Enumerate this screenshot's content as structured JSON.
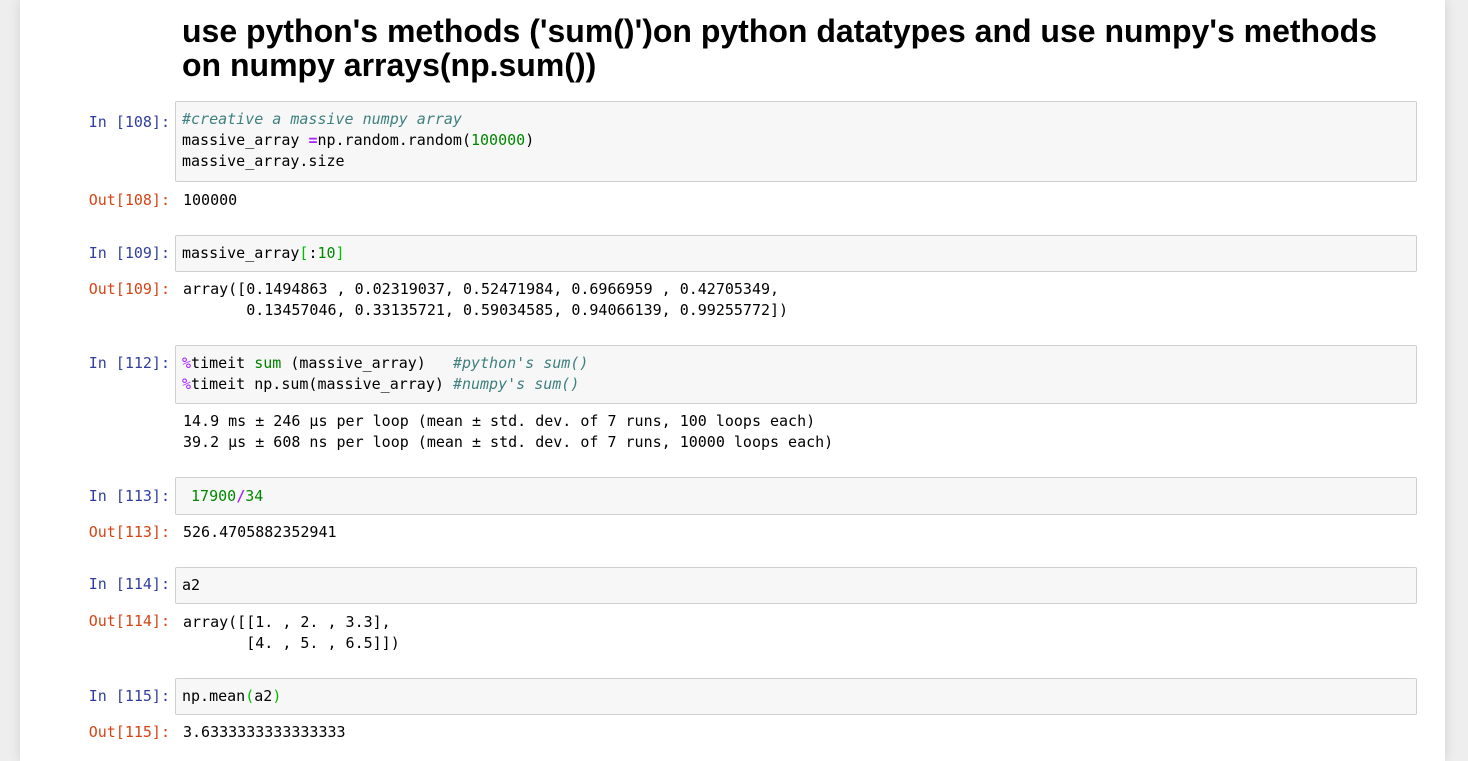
{
  "heading": "use python's methods ('sum()')on python datatypes and use numpy's methods on numpy arrays(np.sum())",
  "cells": [
    {
      "in_prompt": "In [108]:",
      "code": {
        "comment1": "#creative a massive numpy array",
        "l2_a": "massive_array ",
        "l2_op": "=",
        "l2_b": "np.random.random(",
        "l2_num": "100000",
        "l2_c": ")",
        "l3": "massive_array.size"
      },
      "out_prompt": "Out[108]:",
      "output": "100000"
    },
    {
      "in_prompt": "In [109]:",
      "code": {
        "a": "massive_array",
        "b1": "[",
        "c": ":",
        "num": "10",
        "b2": "]"
      },
      "out_prompt": "Out[109]:",
      "output": "array([0.1494863 , 0.02319037, 0.52471984, 0.6966959 , 0.42705349,\n       0.13457046, 0.33135721, 0.59034585, 0.94066139, 0.99255772])"
    },
    {
      "in_prompt": "In [112]:",
      "code": {
        "magic1": "%",
        "l1_a": "timeit ",
        "l1_sum": "sum",
        "l1_b": " (massive_array)   ",
        "l1_comment": "#python's sum()",
        "magic2": "%",
        "l2_a": "timeit np.sum(massive_array) ",
        "l2_comment": "#numpy's sum()"
      },
      "output": "14.9 ms ± 246 µs per loop (mean ± std. dev. of 7 runs, 100 loops each)\n39.2 µs ± 608 ns per loop (mean ± std. dev. of 7 runs, 10000 loops each)"
    },
    {
      "in_prompt": "In [113]:",
      "code": {
        "sp": " ",
        "n1": "17900",
        "op": "/",
        "n2": "34"
      },
      "out_prompt": "Out[113]:",
      "output": "526.4705882352941"
    },
    {
      "in_prompt": "In [114]:",
      "code": {
        "a": "a2"
      },
      "out_prompt": "Out[114]:",
      "output": "array([[1. , 2. , 3.3],\n       [4. , 5. , 6.5]])"
    },
    {
      "in_prompt": "In [115]:",
      "code": {
        "a": "np.mean",
        "b1": "(",
        "c": "a2",
        "b2": ")"
      },
      "out_prompt": "Out[115]:",
      "output": "3.6333333333333333"
    }
  ]
}
